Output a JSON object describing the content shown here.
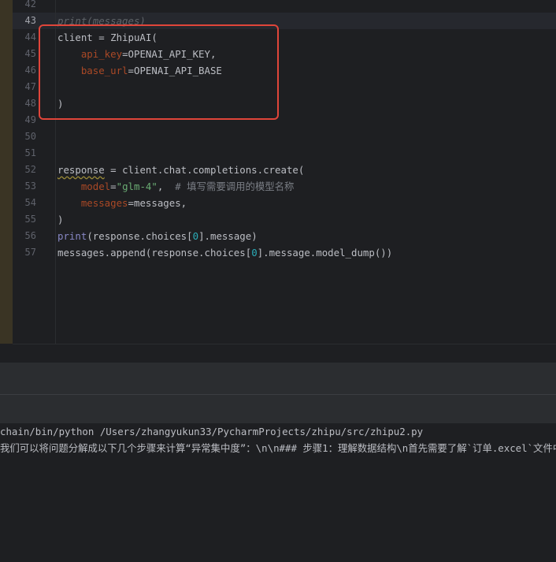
{
  "editor": {
    "current_line": "43",
    "lines": [
      {
        "num": "42",
        "parts": []
      },
      {
        "num": "43",
        "parts": [
          {
            "t": "print(messages)",
            "c": "italic-dim"
          }
        ]
      },
      {
        "num": "44",
        "parts": [
          {
            "t": "client = ZhipuAI(",
            "c": ""
          }
        ]
      },
      {
        "num": "45",
        "parts": [
          {
            "t": "    ",
            "c": ""
          },
          {
            "t": "api_key",
            "c": "kw-param"
          },
          {
            "t": "=OPENAI_API_KEY,",
            "c": ""
          }
        ]
      },
      {
        "num": "46",
        "parts": [
          {
            "t": "    ",
            "c": ""
          },
          {
            "t": "base_url",
            "c": "kw-param"
          },
          {
            "t": "=OPENAI_API_BASE",
            "c": ""
          }
        ]
      },
      {
        "num": "47",
        "parts": []
      },
      {
        "num": "48",
        "parts": [
          {
            "t": ")",
            "c": ""
          }
        ]
      },
      {
        "num": "49",
        "parts": []
      },
      {
        "num": "50",
        "parts": []
      },
      {
        "num": "51",
        "parts": []
      },
      {
        "num": "52",
        "parts": [
          {
            "t": "response",
            "c": "squiggle"
          },
          {
            "t": " = client.chat.completions.create(",
            "c": ""
          }
        ]
      },
      {
        "num": "53",
        "parts": [
          {
            "t": "    ",
            "c": ""
          },
          {
            "t": "model",
            "c": "kw-param"
          },
          {
            "t": "=",
            "c": ""
          },
          {
            "t": "\"glm-4\"",
            "c": "str"
          },
          {
            "t": ",  ",
            "c": ""
          },
          {
            "t": "# 填写需要调用的模型名称",
            "c": "cmt"
          }
        ]
      },
      {
        "num": "54",
        "parts": [
          {
            "t": "    ",
            "c": ""
          },
          {
            "t": "messages",
            "c": "kw-param"
          },
          {
            "t": "=messages,",
            "c": ""
          }
        ]
      },
      {
        "num": "55",
        "parts": [
          {
            "t": ")",
            "c": ""
          }
        ]
      },
      {
        "num": "56",
        "parts": [
          {
            "t": "print",
            "c": "fn-builtin"
          },
          {
            "t": "(response.choices[",
            "c": ""
          },
          {
            "t": "0",
            "c": "num"
          },
          {
            "t": "].message)",
            "c": ""
          }
        ]
      },
      {
        "num": "57",
        "parts": [
          {
            "t": "messages.append(response.choices[",
            "c": ""
          },
          {
            "t": "0",
            "c": "num"
          },
          {
            "t": "].message.model_dump())",
            "c": ""
          }
        ]
      }
    ]
  },
  "console": {
    "command": "chain/bin/python /Users/zhangyukun33/PycharmProjects/zhipu/src/zhipu2.py",
    "output": "我们可以将问题分解成以下几个步骤来计算“异常集中度”：\\n\\n### 步骤1：理解数据结构\\n首先需要了解`订单.excel`文件中的"
  },
  "colors": {
    "highlight_box": "#e0453a",
    "background": "#1e1f22",
    "param": "#aa4926",
    "string": "#6aab73",
    "number": "#2aacb8"
  }
}
